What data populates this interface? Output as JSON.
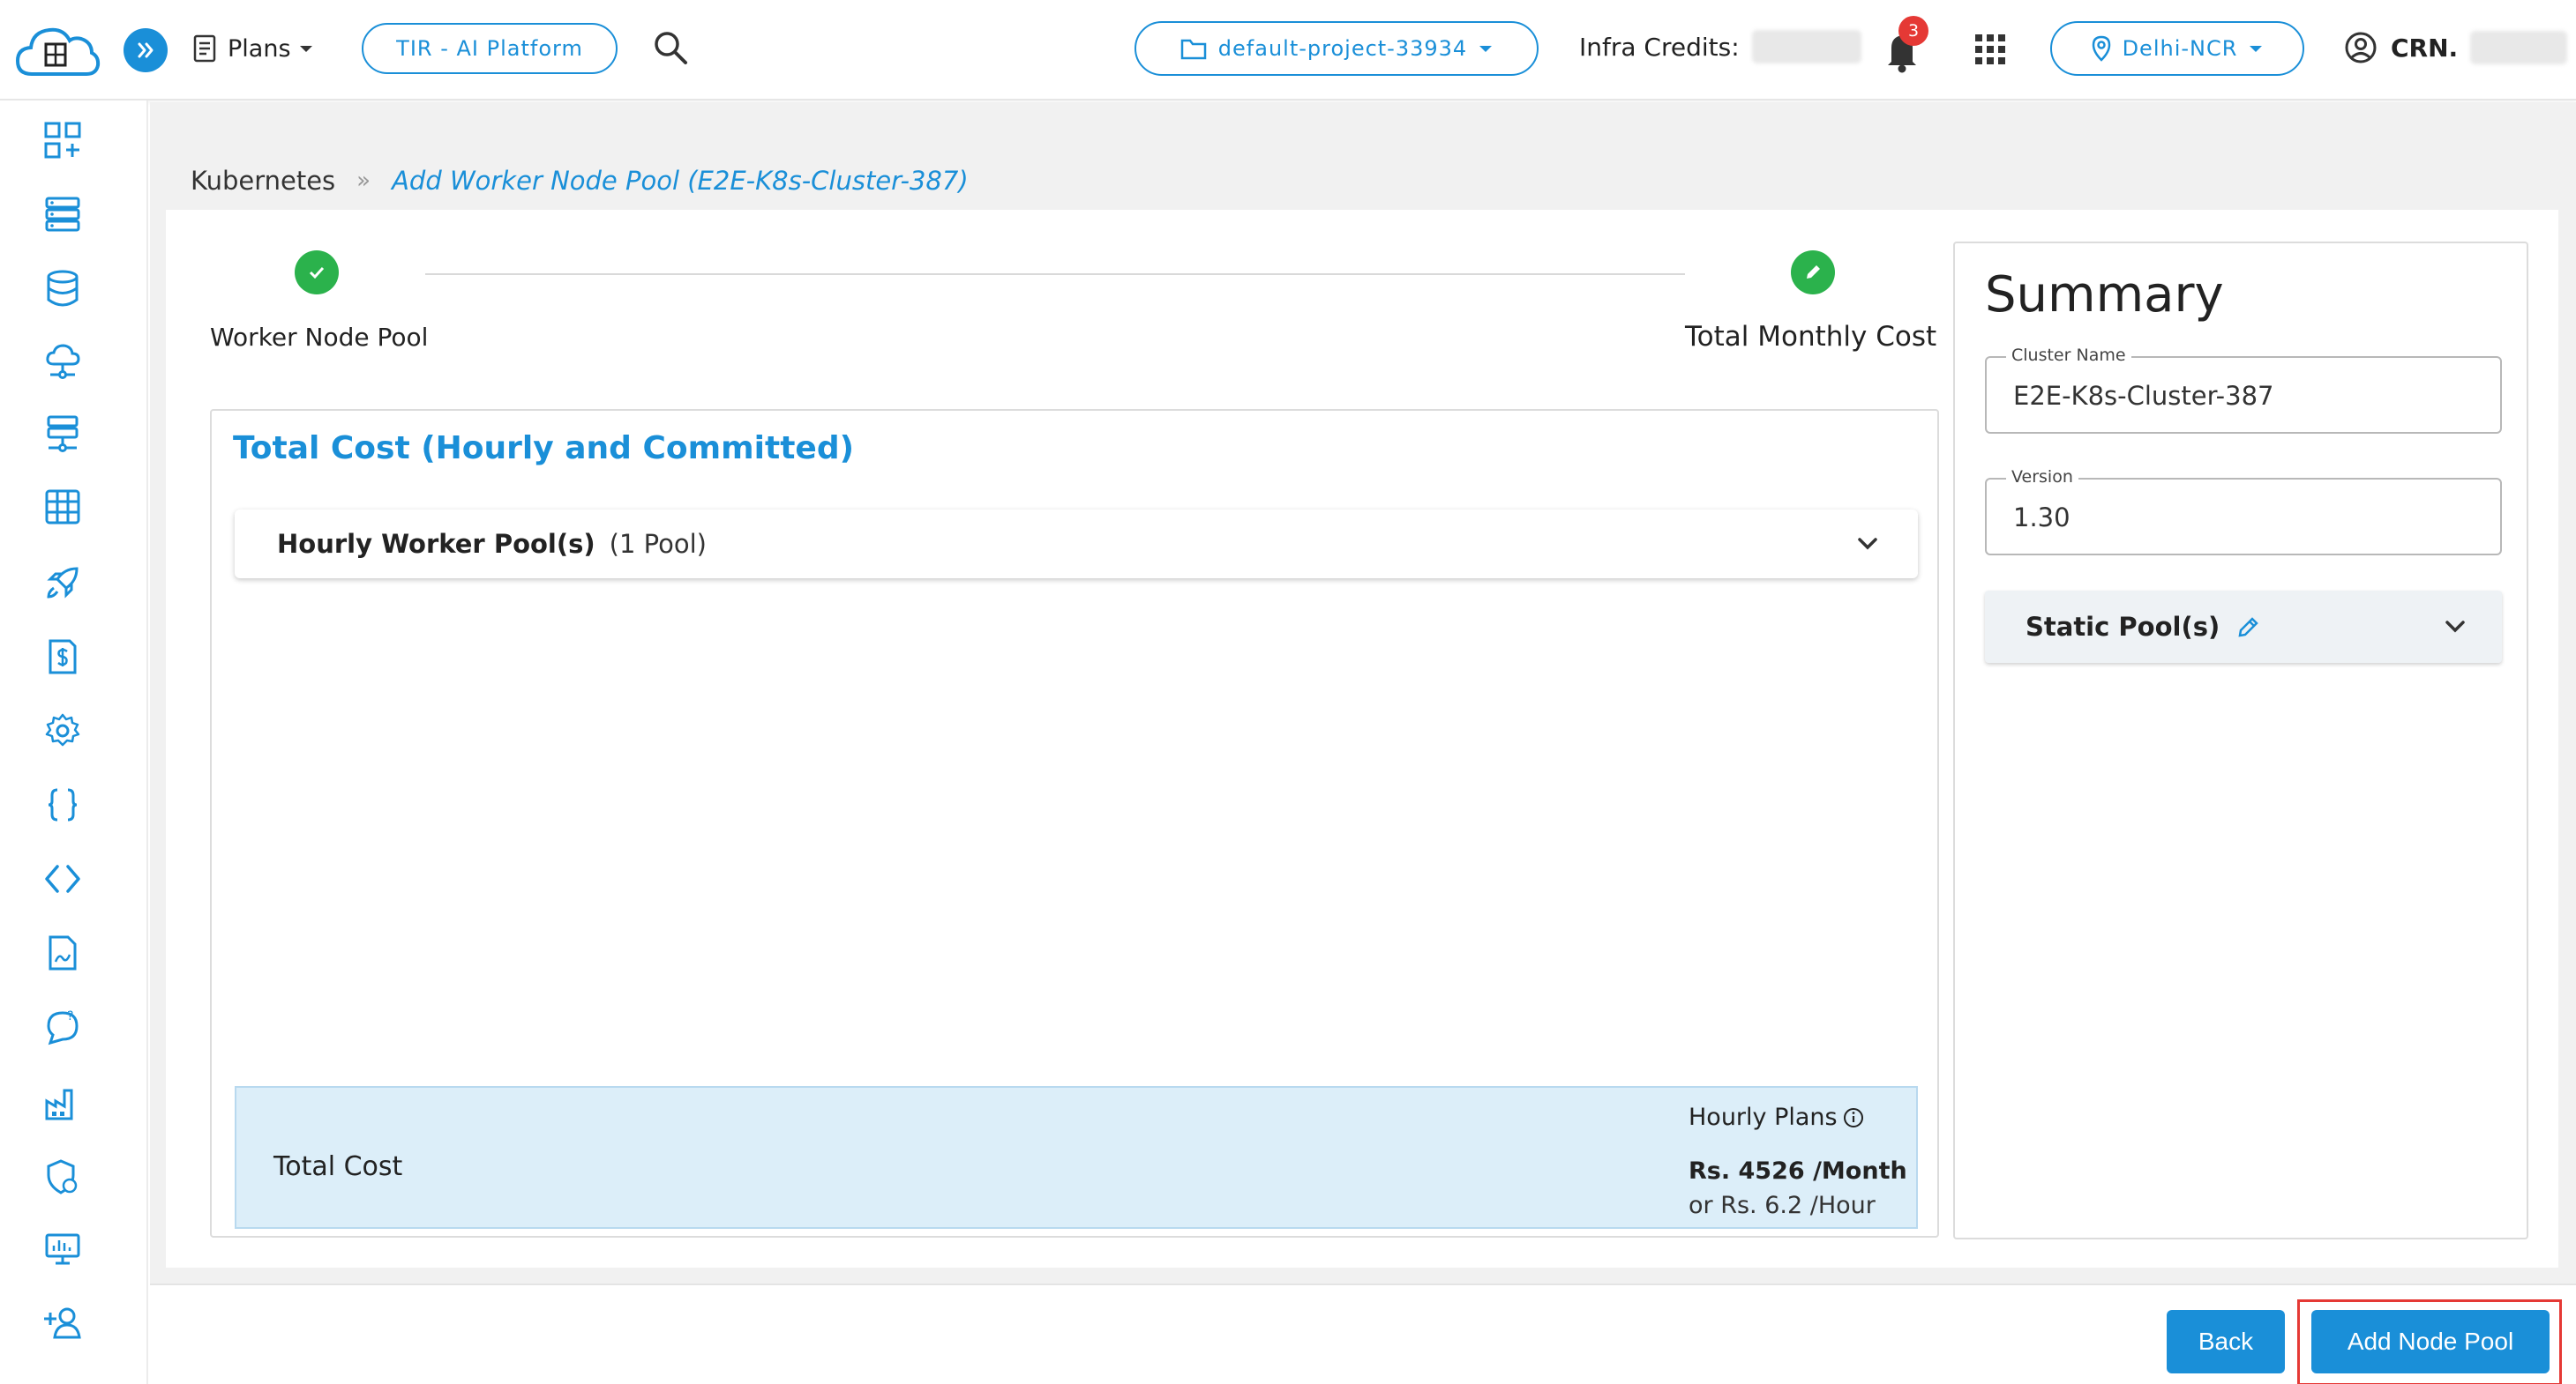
{
  "topbar": {
    "plans_label": "Plans",
    "tir_label": "TIR - AI Platform",
    "project_label": "default-project-33934",
    "infra_credits_label": "Infra Credits:",
    "notification_count": "3",
    "region_label": "Delhi-NCR",
    "crn_label": "CRN."
  },
  "sidebar": {
    "items": [
      {
        "icon": "dashboard-add-icon"
      },
      {
        "icon": "server-list-icon"
      },
      {
        "icon": "database-icon"
      },
      {
        "icon": "cloud-network-icon"
      },
      {
        "icon": "network-server-icon"
      },
      {
        "icon": "grid-table-icon"
      },
      {
        "icon": "rocket-icon"
      },
      {
        "icon": "billing-icon"
      },
      {
        "icon": "settings-icon"
      },
      {
        "icon": "braces-icon"
      },
      {
        "icon": "code-icon"
      },
      {
        "icon": "document-icon"
      },
      {
        "icon": "chat-question-icon"
      },
      {
        "icon": "factory-icon"
      },
      {
        "icon": "security-user-icon"
      },
      {
        "icon": "monitor-icon"
      },
      {
        "icon": "add-user-icon"
      }
    ]
  },
  "breadcrumb": {
    "root": "Kubernetes",
    "separator": "»",
    "current": "Add Worker Node Pool (E2E-K8s-Cluster-387)"
  },
  "stepper": {
    "step1": "Worker Node Pool",
    "step2": "Total Monthly Cost"
  },
  "cost": {
    "title": "Total Cost (Hourly and Committed)",
    "accordion_title": "Hourly Worker Pool(s)",
    "accordion_count": "(1 Pool)",
    "total_label": "Total Cost",
    "plans_label": "Hourly Plans",
    "per_month": "Rs. 4526 /Month",
    "per_hour": "or Rs. 6.2 /Hour"
  },
  "summary": {
    "title": "Summary",
    "cluster_name_label": "Cluster Name",
    "cluster_name_value": "E2E-K8s-Cluster-387",
    "version_label": "Version",
    "version_value": "1.30",
    "static_pools_label": "Static Pool(s)"
  },
  "footer": {
    "back_label": "Back",
    "add_label": "Add Node Pool"
  },
  "colors": {
    "accent": "#1a8fd8",
    "success": "#2bb24c",
    "alert": "#e53935",
    "total_bg": "#dceef9"
  }
}
